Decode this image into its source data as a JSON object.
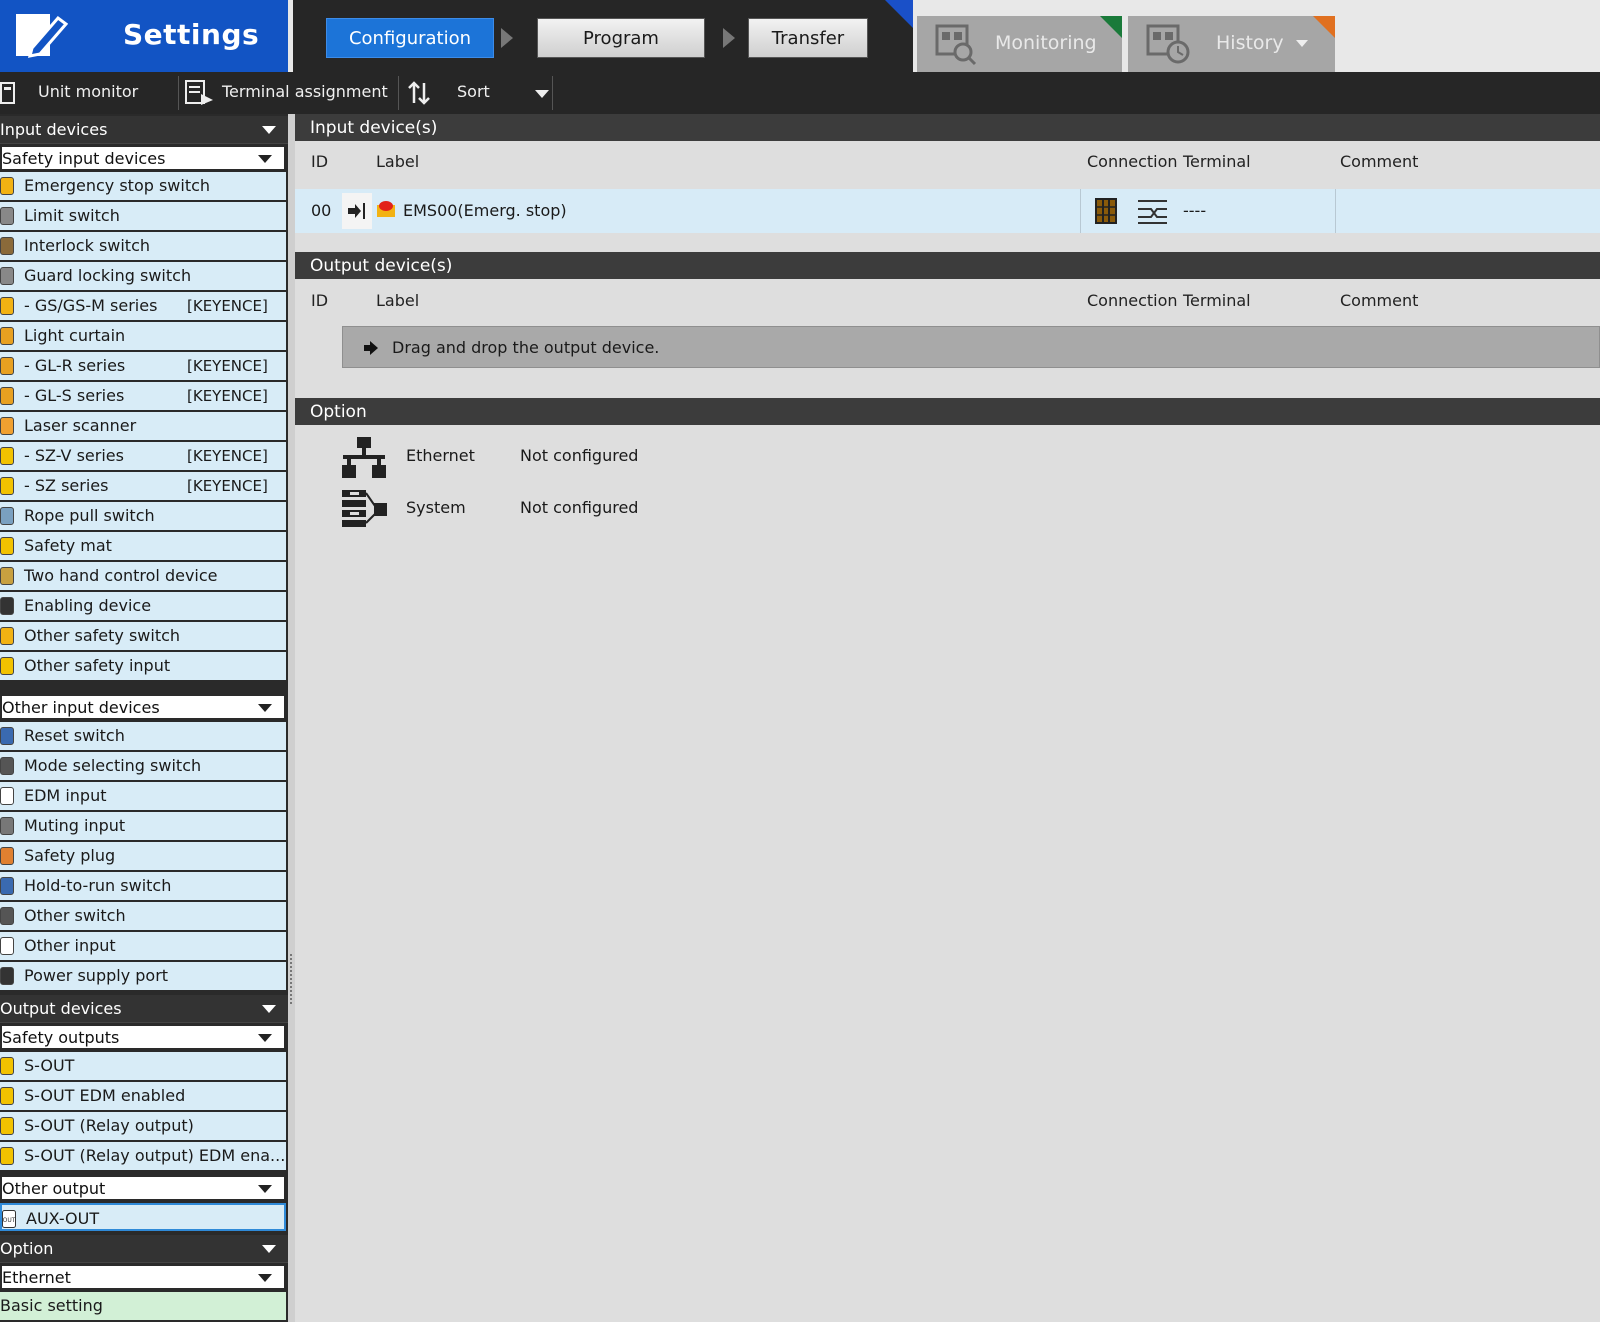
{
  "header": {
    "app_title": "Settings",
    "workflow": {
      "configuration": "Configuration",
      "program": "Program",
      "transfer": "Transfer"
    },
    "tabs": {
      "monitoring": "Monitoring",
      "history": "History"
    },
    "colors": {
      "brand": "#1254c4",
      "active_step": "#1c74d8",
      "monitoring_corner": "#1a7a3a",
      "history_corner": "#e07020",
      "workflow_corner": "#1a50c8"
    }
  },
  "toolbar": {
    "unit_monitor": "Unit monitor",
    "terminal_assignment": "Terminal assignment",
    "sort": "Sort"
  },
  "sidebar": {
    "input_devices": "Input devices",
    "safety_input_devices": "Safety input devices",
    "safety_items": [
      {
        "label": "Emergency stop switch",
        "brand": ""
      },
      {
        "label": "Limit switch",
        "brand": ""
      },
      {
        "label": "Interlock switch",
        "brand": ""
      },
      {
        "label": "Guard locking switch",
        "brand": ""
      },
      {
        "label": "- GS/GS-M series",
        "brand": "[KEYENCE]"
      },
      {
        "label": "Light curtain",
        "brand": ""
      },
      {
        "label": "- GL-R series",
        "brand": "[KEYENCE]"
      },
      {
        "label": "- GL-S series",
        "brand": "[KEYENCE]"
      },
      {
        "label": "Laser scanner",
        "brand": ""
      },
      {
        "label": "- SZ-V series",
        "brand": "[KEYENCE]"
      },
      {
        "label": "- SZ series",
        "brand": "[KEYENCE]"
      },
      {
        "label": "Rope pull switch",
        "brand": ""
      },
      {
        "label": "Safety mat",
        "brand": ""
      },
      {
        "label": "Two hand control device",
        "brand": ""
      },
      {
        "label": "Enabling device",
        "brand": ""
      },
      {
        "label": "Other safety switch",
        "brand": ""
      },
      {
        "label": "Other safety input",
        "brand": ""
      }
    ],
    "other_input_devices": "Other input devices",
    "other_items": [
      {
        "label": "Reset switch"
      },
      {
        "label": "Mode selecting switch"
      },
      {
        "label": "EDM input"
      },
      {
        "label": "Muting input"
      },
      {
        "label": "Safety plug"
      },
      {
        "label": "Hold-to-run switch"
      },
      {
        "label": "Other switch"
      },
      {
        "label": "Other input"
      },
      {
        "label": "Power supply port"
      }
    ],
    "output_devices": "Output devices",
    "safety_outputs": "Safety outputs",
    "output_items": [
      {
        "label": "S-OUT"
      },
      {
        "label": "S-OUT EDM enabled"
      },
      {
        "label": "S-OUT (Relay output)"
      },
      {
        "label": "S-OUT (Relay output) EDM ena..."
      }
    ],
    "other_output": "Other output",
    "aux_item": "AUX-OUT",
    "option": "Option",
    "ethernet": "Ethernet",
    "basic_setting": "Basic setting"
  },
  "main": {
    "input_panel": "Input device(s)",
    "output_panel": "Output device(s)",
    "option_panel": "Option",
    "columns": {
      "id": "ID",
      "label": "Label",
      "connection": "Connection",
      "terminal": "Terminal",
      "comment": "Comment"
    },
    "input_row": {
      "id": "00",
      "label": "EMS00(Emerg. stop)",
      "terminal": "----"
    },
    "dropzone": "Drag and drop the output device.",
    "options": [
      {
        "name": "Ethernet",
        "status": "Not configured"
      },
      {
        "name": "System",
        "status": "Not configured"
      }
    ]
  }
}
